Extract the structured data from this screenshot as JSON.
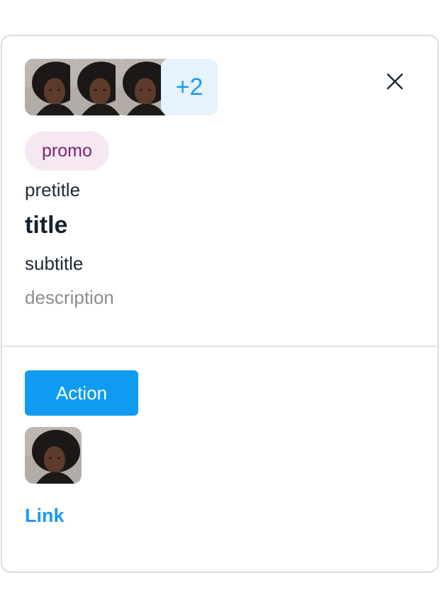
{
  "header": {
    "avatars": [
      {
        "name": "avatar-1"
      },
      {
        "name": "avatar-2"
      },
      {
        "name": "avatar-3"
      }
    ],
    "more_count_label": "+2",
    "close_icon": "close-icon"
  },
  "content": {
    "badge_label": "promo",
    "pretitle": "pretitle",
    "title": "title",
    "subtitle": "subtitle",
    "description": "description"
  },
  "footer": {
    "action_label": "Action",
    "link_label": "Link"
  },
  "colors": {
    "accent": "#0f9bf2",
    "badge_bg": "#f6e8f2",
    "badge_text": "#7a2370",
    "more_bg": "#e6f3fd"
  }
}
